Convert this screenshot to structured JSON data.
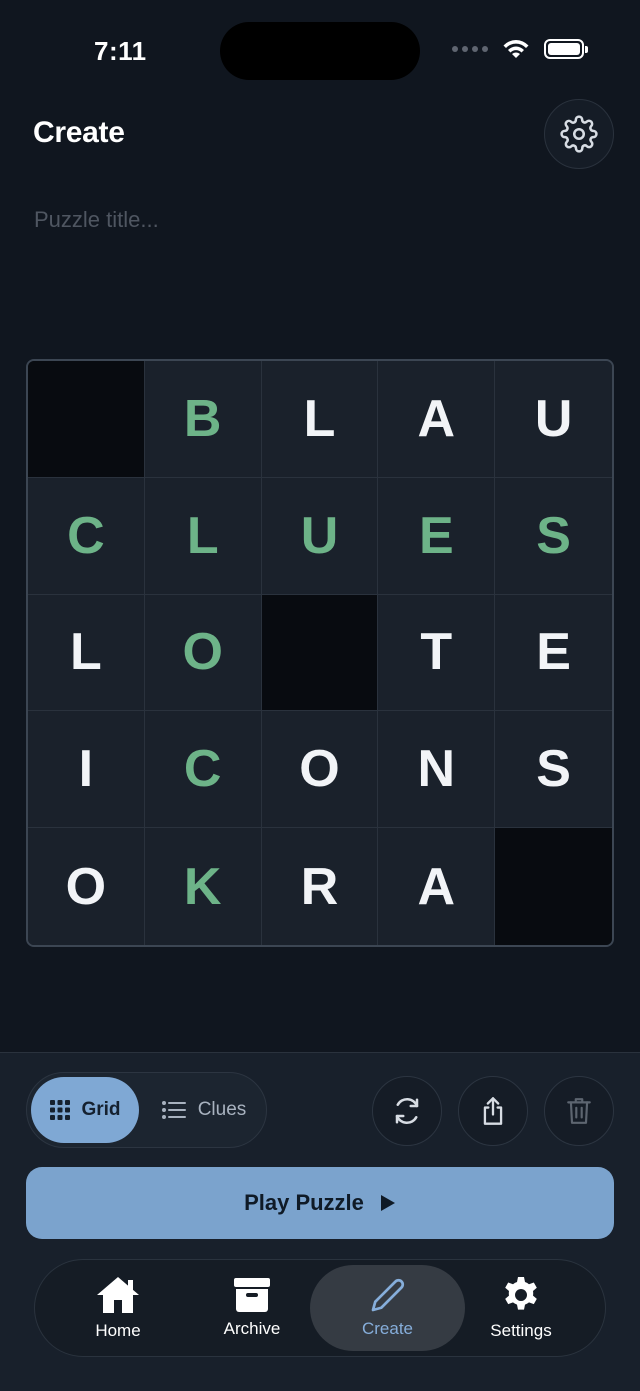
{
  "status": {
    "time": "7:11"
  },
  "header": {
    "title": "Create"
  },
  "title_input": {
    "placeholder": "Puzzle title..."
  },
  "grid": {
    "rows": [
      [
        {
          "t": "",
          "black": true
        },
        {
          "t": "B",
          "green": true
        },
        {
          "t": "L"
        },
        {
          "t": "A"
        },
        {
          "t": "U"
        }
      ],
      [
        {
          "t": "C",
          "green": true
        },
        {
          "t": "L",
          "green": true
        },
        {
          "t": "U",
          "green": true
        },
        {
          "t": "E",
          "green": true
        },
        {
          "t": "S",
          "green": true
        }
      ],
      [
        {
          "t": "L"
        },
        {
          "t": "O",
          "green": true
        },
        {
          "t": "",
          "black": true
        },
        {
          "t": "T"
        },
        {
          "t": "E"
        }
      ],
      [
        {
          "t": "I"
        },
        {
          "t": "C",
          "green": true
        },
        {
          "t": "O"
        },
        {
          "t": "N"
        },
        {
          "t": "S"
        }
      ],
      [
        {
          "t": "O"
        },
        {
          "t": "K",
          "green": true
        },
        {
          "t": "R"
        },
        {
          "t": "A"
        },
        {
          "t": "",
          "black": true
        }
      ]
    ]
  },
  "mode_toggle": {
    "grid_label": "Grid",
    "clues_label": "Clues",
    "selected": "Grid"
  },
  "actions": {
    "play_label": "Play Puzzle"
  },
  "tabbar": {
    "items": [
      {
        "label": "Home",
        "icon": "home-icon"
      },
      {
        "label": "Archive",
        "icon": "archive-icon"
      },
      {
        "label": "Create",
        "icon": "pencil-icon",
        "active": true
      },
      {
        "label": "Settings",
        "icon": "gear-icon"
      }
    ]
  },
  "colors": {
    "accent": "#7ba3cd",
    "green_letter": "#6db388",
    "background": "#10161f"
  }
}
